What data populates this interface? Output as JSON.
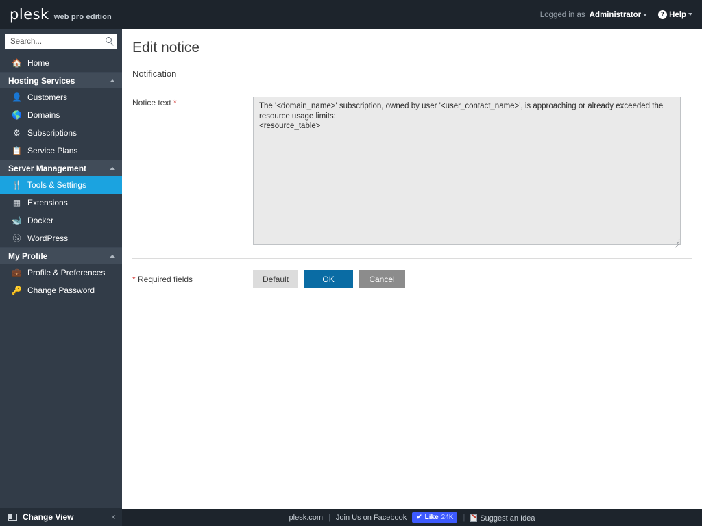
{
  "header": {
    "logo_text": "plesk",
    "logo_edition": "web pro edition",
    "logged_in_as_label": "Logged in as",
    "user_name": "Administrator",
    "help_label": "Help",
    "help_icon": "question-circle-icon",
    "user_caret_icon": "chevron-down-icon",
    "help_caret_icon": "chevron-down-icon"
  },
  "sidebar": {
    "search": {
      "placeholder": "Search...",
      "value": "",
      "icon": "search-icon"
    },
    "home": {
      "label": "Home",
      "icon": "home-icon"
    },
    "sections": [
      {
        "title": "Hosting Services",
        "caret_icon": "chevron-up-icon",
        "items": [
          {
            "label": "Customers",
            "icon": "user-icon"
          },
          {
            "label": "Domains",
            "icon": "globe-icon"
          },
          {
            "label": "Subscriptions",
            "icon": "gear-icon"
          },
          {
            "label": "Service Plans",
            "icon": "clipboard-icon"
          }
        ]
      },
      {
        "title": "Server Management",
        "caret_icon": "chevron-up-icon",
        "items": [
          {
            "label": "Tools & Settings",
            "icon": "tools-icon",
            "active": true
          },
          {
            "label": "Extensions",
            "icon": "blocks-icon"
          },
          {
            "label": "Docker",
            "icon": "whale-icon"
          },
          {
            "label": "WordPress",
            "icon": "wordpress-icon"
          }
        ]
      },
      {
        "title": "My Profile",
        "caret_icon": "chevron-up-icon",
        "items": [
          {
            "label": "Profile & Preferences",
            "icon": "id-card-icon"
          },
          {
            "label": "Change Password",
            "icon": "key-icon"
          }
        ]
      }
    ],
    "change_view": {
      "label": "Change View",
      "icon": "layout-icon",
      "close_icon": "close-icon",
      "close_label": "×"
    }
  },
  "main": {
    "page_title": "Edit notice",
    "section_title": "Notification",
    "notice_label": "Notice text",
    "required_marker": "*",
    "notice_text": "The '<domain_name>' subscription, owned by user '<user_contact_name>', is approaching or already exceeded the resource usage limits:\n<resource_table>",
    "required_fields_marker": "*",
    "required_fields_label": "Required fields",
    "buttons": {
      "default_label": "Default",
      "ok_label": "OK",
      "cancel_label": "Cancel"
    }
  },
  "footer": {
    "site_link": "plesk.com",
    "separator": "|",
    "facebook_label": "Join Us on Facebook",
    "like_check": "✔",
    "like_label": "Like",
    "like_count": "24K",
    "separator2": "|",
    "suggest_label": "Suggest an Idea",
    "suggest_icon": "idea-icon"
  },
  "colors": {
    "topbar": "#1d242c",
    "sidebar": "#323c48",
    "sidebar_section": "#414c59",
    "accent_active": "#1ba3e0",
    "ok_button": "#0a6ca4",
    "cancel_button": "#8c8c8c",
    "required_red": "#d0322f",
    "logo_underline": "#00a2d4",
    "facebook_blue": "#3d5afe"
  }
}
